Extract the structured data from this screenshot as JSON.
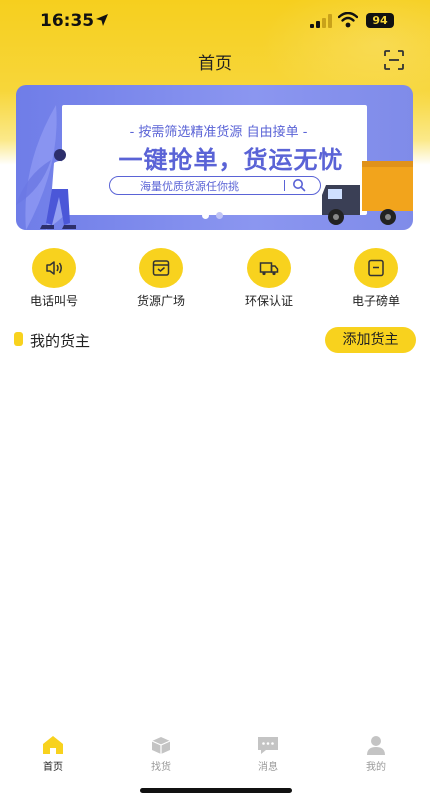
{
  "status_bar": {
    "time": "16:35",
    "battery": "94"
  },
  "nav": {
    "title": "首页",
    "scan_icon": "scan-icon"
  },
  "banner": {
    "subtitle": "- 按需筛选精准货源  自由接单 -",
    "headline": "一键抢单，货运无忧",
    "search_text": "海量优质货源任你挑",
    "colors": {
      "primary": "#5a63d6",
      "background": "#7f8be9"
    },
    "carousel": {
      "count": 2,
      "active_index": 0
    }
  },
  "quick_actions": [
    {
      "label": "电话叫号",
      "icon": "speaker-icon"
    },
    {
      "label": "货源广场",
      "icon": "box-icon"
    },
    {
      "label": "环保认证",
      "icon": "truck-icon"
    },
    {
      "label": "电子磅单",
      "icon": "ticket-icon"
    }
  ],
  "section": {
    "title": "我的货主",
    "add_button": "添加货主"
  },
  "tabbar": [
    {
      "label": "首页",
      "icon": "home-icon",
      "active": true
    },
    {
      "label": "找货",
      "icon": "parcel-icon",
      "active": false
    },
    {
      "label": "消息",
      "icon": "message-icon",
      "active": false
    },
    {
      "label": "我的",
      "icon": "user-icon",
      "active": false
    }
  ],
  "colors": {
    "accent": "#f8d21e",
    "text": "#222222",
    "inactive": "#9a9a9a"
  }
}
